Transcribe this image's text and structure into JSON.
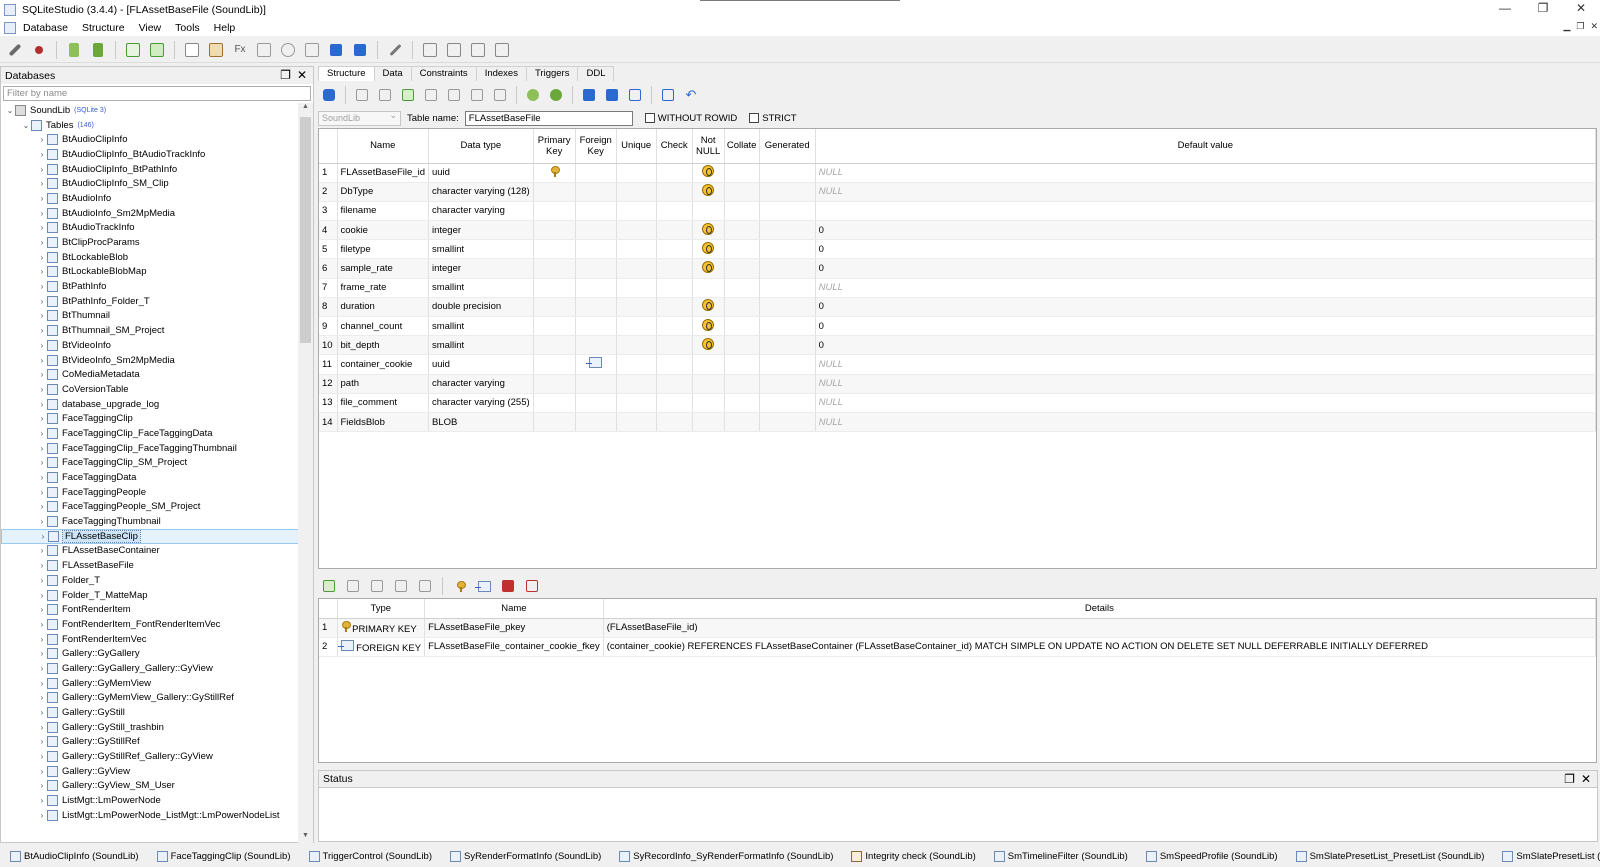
{
  "window": {
    "title": "SQLiteStudio (3.4.4) - [FLAssetBaseFile (SoundLib)]",
    "controls": {
      "minimize": "—",
      "restore": "❐",
      "close": "✕"
    }
  },
  "menu": [
    "Database",
    "Structure",
    "View",
    "Tools",
    "Help"
  ],
  "databases_panel": {
    "title": "Databases",
    "filter_placeholder": "Filter by name",
    "db_name": "SoundLib",
    "db_version": "(SQLite 3)",
    "tables_label": "Tables",
    "tables_count": "(146)",
    "tables": [
      "BtAudioClipInfo",
      "BtAudioClipInfo_BtAudioTrackInfo",
      "BtAudioClipInfo_BtPathInfo",
      "BtAudioClipInfo_SM_Clip",
      "BtAudioInfo",
      "BtAudioInfo_Sm2MpMedia",
      "BtAudioTrackInfo",
      "BtClipProcParams",
      "BtLockableBlob",
      "BtLockableBlobMap",
      "BtPathInfo",
      "BtPathInfo_Folder_T",
      "BtThumnail",
      "BtThumnail_SM_Project",
      "BtVideoInfo",
      "BtVideoInfo_Sm2MpMedia",
      "CoMediaMetadata",
      "CoVersionTable",
      "database_upgrade_log",
      "FaceTaggingClip",
      "FaceTaggingClip_FaceTaggingData",
      "FaceTaggingClip_FaceTaggingThumbnail",
      "FaceTaggingClip_SM_Project",
      "FaceTaggingData",
      "FaceTaggingPeople",
      "FaceTaggingPeople_SM_Project",
      "FaceTaggingThumbnail",
      "FLAssetBaseClip",
      "FLAssetBaseContainer",
      "FLAssetBaseFile",
      "Folder_T",
      "Folder_T_MatteMap",
      "FontRenderItem",
      "FontRenderItem_FontRenderItemVec",
      "FontRenderItemVec",
      "Gallery::GyGallery",
      "Gallery::GyGallery_Gallery::GyView",
      "Gallery::GyMemView",
      "Gallery::GyMemView_Gallery::GyStillRef",
      "Gallery::GyStill",
      "Gallery::GyStill_trashbin",
      "Gallery::GyStillRef",
      "Gallery::GyStillRef_Gallery::GyView",
      "Gallery::GyView",
      "Gallery::GyView_SM_User",
      "ListMgt::LmPowerNode",
      "ListMgt::LmPowerNode_ListMgt::LmPowerNodeList"
    ],
    "selected_table": "FLAssetBaseClip"
  },
  "editor": {
    "tabs": [
      "Structure",
      "Data",
      "Constraints",
      "Indexes",
      "Triggers",
      "DDL"
    ],
    "active_tab": "Structure",
    "db_combo": "SoundLib",
    "table_name_label": "Table name:",
    "table_name": "FLAssetBaseFile",
    "without_rowid": "WITHOUT ROWID",
    "strict": "STRICT",
    "columns_header": [
      "Name",
      "Data type",
      "Primary Key",
      "Foreign Key",
      "Unique",
      "Check",
      "Not NULL",
      "Collate",
      "Generated",
      "Default value"
    ],
    "columns": [
      {
        "num": "1",
        "name": "FLAssetBaseFile_id",
        "type": "uuid",
        "pk": true,
        "fk": false,
        "nn": true,
        "default": "NULL"
      },
      {
        "num": "2",
        "name": "DbType",
        "type": "character varying (128)",
        "pk": false,
        "fk": false,
        "nn": true,
        "default": "NULL"
      },
      {
        "num": "3",
        "name": "filename",
        "type": "character varying",
        "pk": false,
        "fk": false,
        "nn": false,
        "default": ""
      },
      {
        "num": "4",
        "name": "cookie",
        "type": "integer",
        "pk": false,
        "fk": false,
        "nn": true,
        "default": "0"
      },
      {
        "num": "5",
        "name": "filetype",
        "type": "smallint",
        "pk": false,
        "fk": false,
        "nn": true,
        "default": "0"
      },
      {
        "num": "6",
        "name": "sample_rate",
        "type": "integer",
        "pk": false,
        "fk": false,
        "nn": true,
        "default": "0"
      },
      {
        "num": "7",
        "name": "frame_rate",
        "type": "smallint",
        "pk": false,
        "fk": false,
        "nn": false,
        "default": "NULL"
      },
      {
        "num": "8",
        "name": "duration",
        "type": "double precision",
        "pk": false,
        "fk": false,
        "nn": true,
        "default": "0"
      },
      {
        "num": "9",
        "name": "channel_count",
        "type": "smallint",
        "pk": false,
        "fk": false,
        "nn": true,
        "default": "0"
      },
      {
        "num": "10",
        "name": "bit_depth",
        "type": "smallint",
        "pk": false,
        "fk": false,
        "nn": true,
        "default": "0"
      },
      {
        "num": "11",
        "name": "container_cookie",
        "type": "uuid",
        "pk": false,
        "fk": true,
        "nn": false,
        "default": "NULL"
      },
      {
        "num": "12",
        "name": "path",
        "type": "character varying",
        "pk": false,
        "fk": false,
        "nn": false,
        "default": "NULL"
      },
      {
        "num": "13",
        "name": "file_comment",
        "type": "character varying (255)",
        "pk": false,
        "fk": false,
        "nn": false,
        "default": "NULL"
      },
      {
        "num": "14",
        "name": "FieldsBlob",
        "type": "BLOB",
        "pk": false,
        "fk": false,
        "nn": false,
        "default": "NULL"
      }
    ],
    "constraints_header": [
      "Type",
      "Name",
      "Details"
    ],
    "constraints": [
      {
        "num": "1",
        "type": "PRIMARY KEY",
        "name": "FLAssetBaseFile_pkey",
        "details": "(FLAssetBaseFile_id)",
        "icon": "key"
      },
      {
        "num": "2",
        "type": "FOREIGN KEY",
        "name": "FLAssetBaseFile_container_cookie_fkey",
        "details": "(container_cookie) REFERENCES FLAssetBaseContainer (FLAssetBaseContainer_id) MATCH SIMPLE ON UPDATE NO ACTION ON DELETE SET NULL DEFERRABLE INITIALLY DEFERRED",
        "icon": "fk"
      }
    ]
  },
  "status_panel": {
    "title": "Status"
  },
  "taskbar": [
    {
      "label": "BtAudioClipInfo (SoundLib)",
      "icon": "table"
    },
    {
      "label": "FaceTaggingClip (SoundLib)",
      "icon": "table"
    },
    {
      "label": "TriggerControl (SoundLib)",
      "icon": "table"
    },
    {
      "label": "SyRenderFormatInfo (SoundLib)",
      "icon": "table"
    },
    {
      "label": "SyRecordInfo_SyRenderFormatInfo (SoundLib)",
      "icon": "table"
    },
    {
      "label": "Integrity check (SoundLib)",
      "icon": "gear"
    },
    {
      "label": "SmTimelineFilter (SoundLib)",
      "icon": "table"
    },
    {
      "label": "SmSpeedProfile (SoundLib)",
      "icon": "table"
    },
    {
      "label": "SmSlatePresetList_PresetList (SoundLib)",
      "icon": "table"
    },
    {
      "label": "SmSlatePresetList (SoundLib)",
      "icon": "table"
    }
  ],
  "colors": {
    "selection": "#cde4f7",
    "null_text": "#a8a8a8",
    "badge": "#3a5fcd"
  }
}
